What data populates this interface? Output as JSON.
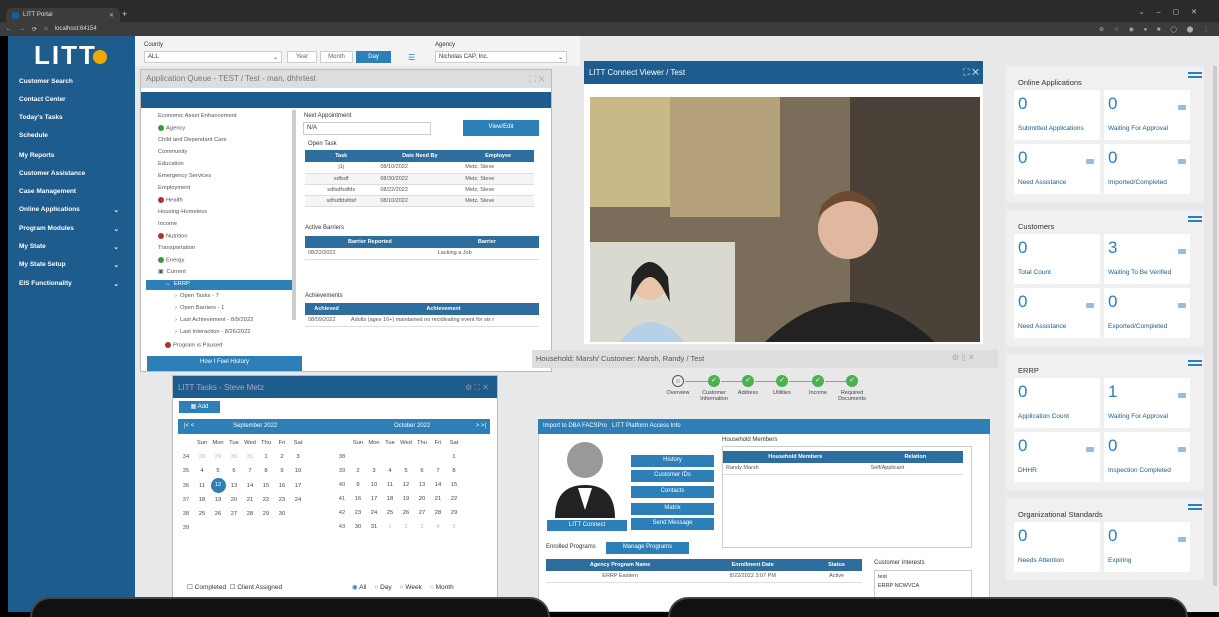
{
  "browser": {
    "tab_title": "LITT Portal",
    "url": "localhost:64154"
  },
  "app": {
    "logo": "LITT"
  },
  "sidebar": {
    "items": [
      "Customer Search",
      "Contact Center",
      "Today's Tasks",
      "Schedule",
      "My Reports",
      "Customer Assistance",
      "Case Management",
      "Online Applications",
      "Program Modules",
      "My State",
      "My State Setup",
      "EIS Functionality"
    ]
  },
  "toolbar": {
    "county_label": "County",
    "county_value": "ALL",
    "year": "Year",
    "month": "Month",
    "day": "Day",
    "agency_label": "Agency",
    "agency_value": "Nicholas CAP, Inc."
  },
  "queue": {
    "title": "Application Queue - TEST / Test - man, dhhrtest",
    "tree": [
      "Economic Asset Enhancement",
      "Agency",
      "Child and Dependant Care",
      "Community",
      "Education",
      "Emergency Services",
      "Employment",
      "Health",
      "Housing-Homeless",
      "Income",
      "Nutrition",
      "Transportation",
      "Energy",
      "Current",
      "ERRP",
      "Open Tasks - 7",
      "Open Barriers - 1",
      "Last Achievement - 8/9/2022",
      "Last Interaction - 8/26/2022",
      "Program is Paused"
    ],
    "next_appt_label": "Next Appointment",
    "next_appt_value": "N/A",
    "view_edit": "View/Edit",
    "open_task_label": "Open Task",
    "task_headers": [
      "Task",
      "Date Need By",
      "Employee"
    ],
    "tasks": [
      [
        "j1j",
        "08/10/2022",
        "Metz, Steve"
      ],
      [
        "sdfsdf",
        "08/30/2022",
        "Metz, Steve"
      ],
      [
        "sdfsdfsdfds",
        "08/22/2022",
        "Metz, Steve"
      ],
      [
        "sdfsdfdsfdsf",
        "08/10/2022",
        "Metz, Steve"
      ]
    ],
    "barriers_label": "Active Barriers",
    "barrier_headers": [
      "Barrier Reported",
      "Barrier"
    ],
    "barriers": [
      [
        "08/22/2022",
        "Lacking a Job"
      ]
    ],
    "achievements_label": "Achievements",
    "ach_headers": [
      "Achieved",
      "Achievement"
    ],
    "achievements": [
      [
        "08/09/2022",
        "Adults (ages 16+) maintained no recidivating event for six r"
      ]
    ],
    "history_btn": "How I Feel History"
  },
  "viewer": {
    "title": "LITT Connect Viewer / Test"
  },
  "tasks_panel": {
    "title": "LITT Tasks - Steve Metz",
    "add": "Add",
    "cal1": {
      "month": "September 2022",
      "weeks": [
        [
          "34",
          "28",
          "29",
          "30",
          "31",
          "1",
          "2",
          "3"
        ],
        [
          "35",
          "4",
          "5",
          "6",
          "7",
          "8",
          "9",
          "10"
        ],
        [
          "36",
          "11",
          "12",
          "13",
          "14",
          "15",
          "16",
          "17"
        ],
        [
          "37",
          "18",
          "19",
          "20",
          "21",
          "22",
          "23",
          "24"
        ],
        [
          "38",
          "25",
          "26",
          "27",
          "28",
          "29",
          "30",
          ""
        ],
        [
          "39",
          "",
          "",
          "",
          "",
          "",
          "",
          ""
        ]
      ]
    },
    "cal2": {
      "month": "October 2022",
      "weeks": [
        [
          "38",
          "",
          "",
          "",
          "",
          "",
          "",
          "1"
        ],
        [
          "39",
          "2",
          "3",
          "4",
          "5",
          "6",
          "7",
          "8"
        ],
        [
          "40",
          "9",
          "10",
          "11",
          "12",
          "13",
          "14",
          "15"
        ],
        [
          "41",
          "16",
          "17",
          "18",
          "19",
          "20",
          "21",
          "22"
        ],
        [
          "42",
          "23",
          "24",
          "25",
          "26",
          "27",
          "28",
          "29"
        ],
        [
          "43",
          "30",
          "31",
          "1",
          "2",
          "3",
          "4",
          "5"
        ]
      ]
    },
    "dow": [
      "Sun",
      "Mon",
      "Tue",
      "Wed",
      "Thu",
      "Fri",
      "Sat"
    ],
    "completed": "Completed",
    "client_assigned": "Client Assigned",
    "radios": [
      "All",
      "Day",
      "Week",
      "Month"
    ]
  },
  "household": {
    "title": "Household: Marsh/ Customer: Marsh, Randy / Test",
    "steps": [
      "Overview",
      "Customer Information",
      "Address",
      "Utilities",
      "Income",
      "Required Documents"
    ],
    "import_bar": [
      "Import to DBA FACSPro",
      "LITT Platform Access Info"
    ],
    "buttons": [
      "History",
      "Customer IDs",
      "Contacts",
      "Matrix",
      "Send Message"
    ],
    "litt_connect": "LITT Connect",
    "members_label": "Household Members",
    "member_headers": [
      "Household Members",
      "Relation"
    ],
    "members": [
      [
        "Randy Marsh",
        "Self/Applicant"
      ]
    ],
    "enrolled_label": "Enrolled Programs",
    "manage": "Manage Programs",
    "prog_headers": [
      "Agency Program Name",
      "Enrollment Date",
      "Status"
    ],
    "programs": [
      [
        "ERRP Eastern",
        "8/22/2022 3:07 PM",
        "Active"
      ]
    ],
    "interests_label": "Customer Interests",
    "interests": [
      "test",
      "ERRP NCWVCA"
    ]
  },
  "dash": {
    "online": {
      "title": "Online Applications",
      "cards": [
        [
          "0",
          "Submitted Applications"
        ],
        [
          "0",
          "Waiting For Approval"
        ],
        [
          "0",
          "Need Assistance"
        ],
        [
          "0",
          "Imported/Completed"
        ]
      ]
    },
    "customers": {
      "title": "Customers",
      "cards": [
        [
          "0",
          "Total Count"
        ],
        [
          "3",
          "Waiting To Be Verified"
        ],
        [
          "0",
          "Need Assistance"
        ],
        [
          "0",
          "Exported/Completed"
        ]
      ]
    },
    "errp": {
      "title": "ERRP",
      "cards": [
        [
          "0",
          "Application Count"
        ],
        [
          "1",
          "Waiting For Approval"
        ],
        [
          "0",
          "DHHR"
        ],
        [
          "0",
          "Inspection Completed"
        ]
      ]
    },
    "org": {
      "title": "Organizational Standards",
      "cards": [
        [
          "0",
          "Needs Attention"
        ],
        [
          "0",
          "Expiring"
        ]
      ]
    }
  },
  "colors": {
    "brand": "#1d5c8c",
    "accent": "#2d7fb8",
    "success": "#4caf50",
    "highlight": "#f2a800"
  }
}
